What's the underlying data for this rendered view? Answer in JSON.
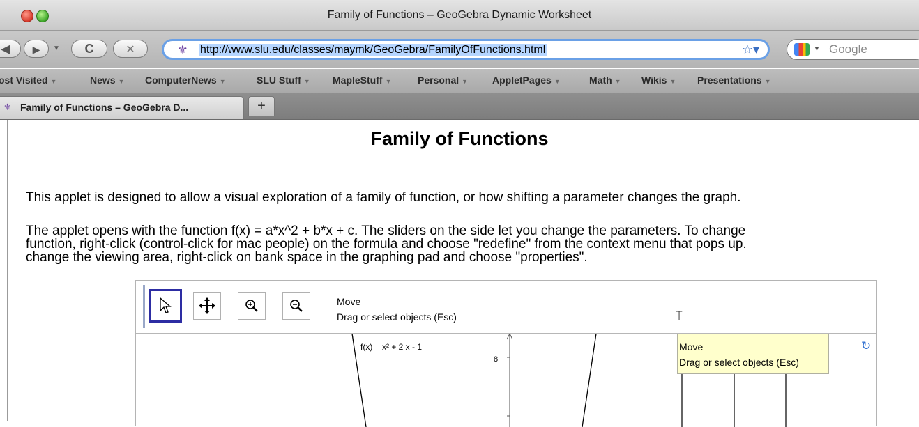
{
  "window": {
    "title": "Family of Functions – GeoGebra Dynamic Worksheet"
  },
  "nav": {
    "url": "http://www.slu.edu/classes/maymk/GeoGebra/FamilyOfFunctions.html",
    "search_placeholder": "Google"
  },
  "bookmarks": [
    "ost Visited",
    "News",
    "ComputerNews",
    "SLU Stuff",
    "MapleStuff",
    "Personal",
    "AppletPages",
    "Math",
    "Wikis",
    "Presentations"
  ],
  "tabs": [
    {
      "label": "Family of Functions – GeoGebra D..."
    }
  ],
  "newtab_label": "+",
  "page": {
    "title": "Family of Functions",
    "para1": "This applet is designed to allow a visual exploration of a family of function, or how shifting a parameter changes the graph.",
    "para2_line1": "The applet opens with the function f(x) = a*x^2 + b*x + c.  The sliders on the side let you change the parameters.  To change",
    "para2_line2": "function, right-click (control-click for mac people) on the formula and choose \"redefine\" from the context menu that pops up.",
    "para2_line3": "change the viewing area, right-click on bank space in the graphing pad and choose \"properties\"."
  },
  "applet": {
    "tool_name": "Move",
    "tool_desc": "Drag or select objects (Esc)",
    "function_label": "f(x) = x² + 2 x - 1",
    "y_tick": "8",
    "tooltip_title": "Move",
    "tooltip_desc": "Drag or select objects (Esc)"
  },
  "colors": {
    "selected_tool_border": "#2d2da3",
    "url_focus": "#6aa0e6",
    "tooltip_bg": "#ffffcc"
  }
}
